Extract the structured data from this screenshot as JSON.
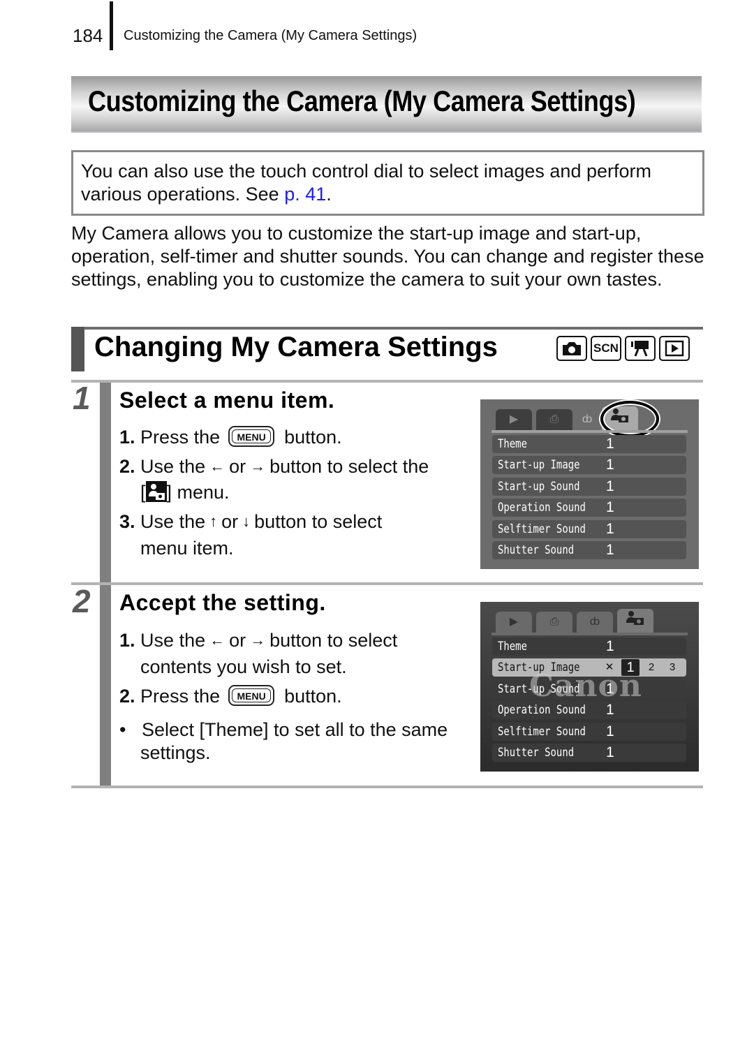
{
  "header": {
    "page_number": "184",
    "running_title": "Customizing the Camera (My Camera Settings)"
  },
  "title": "Customizing the Camera (My Camera Settings)",
  "note": {
    "text_before": "You can also use the touch control dial to select images and perform various operations. See ",
    "link": "p. 41",
    "text_after": "."
  },
  "intro": "My Camera allows you to customize the start-up image and start-up, operation, self-timer and shutter sounds. You can change and register these settings, enabling you to customize the camera to suit your own tastes.",
  "section": {
    "title": "Changing My Camera Settings",
    "mode_icons": [
      {
        "name": "camera-icon",
        "label": "◘"
      },
      {
        "name": "scn-icon",
        "label": "SCN"
      },
      {
        "name": "movie-icon",
        "label": "🎥"
      },
      {
        "name": "playback-icon",
        "label": "▶"
      }
    ]
  },
  "steps": [
    {
      "number": "1",
      "title": "Select a menu item.",
      "instructions": {
        "i1_num": "1.",
        "i1_a": "Press the",
        "i1_btn": "MENU",
        "i1_b": "button.",
        "i2_num": "2.",
        "i2_a": "Use the",
        "i2_arrow1": "←",
        "i2_or": "or",
        "i2_arrow2": "→",
        "i2_b": "button to select the",
        "i2_c_open": "[",
        "i2_c_close": "] menu.",
        "i3_num": "3.",
        "i3_a": "Use the",
        "i3_arrow1": "↑",
        "i3_or": "or",
        "i3_arrow2": "↓",
        "i3_b": "button to select",
        "i3_c": "menu item."
      },
      "screen": {
        "tabs": [
          "▶",
          "⎙",
          "ȸ",
          "👤"
        ],
        "rows": [
          {
            "label": "Theme",
            "value": "1"
          },
          {
            "label": "Start-up Image",
            "value": "1"
          },
          {
            "label": "Start-up Sound",
            "value": "1"
          },
          {
            "label": "Operation Sound",
            "value": "1"
          },
          {
            "label": "Selftimer Sound",
            "value": "1"
          },
          {
            "label": "Shutter Sound",
            "value": "1"
          }
        ]
      }
    },
    {
      "number": "2",
      "title": "Accept the setting.",
      "instructions": {
        "i1_num": "1.",
        "i1_a": "Use the",
        "i1_arrow1": "←",
        "i1_or": "or",
        "i1_arrow2": "→",
        "i1_b": "button to select",
        "i1_c": "contents you wish to set.",
        "i2_num": "2.",
        "i2_a": "Press the",
        "i2_btn": "MENU",
        "i2_b": "button.",
        "bullet": "•",
        "bullet_text": "Select [Theme] to set all to the same",
        "bullet_text2": "settings."
      },
      "screen": {
        "tabs": [
          "▶",
          "⎙",
          "ȸ",
          "👤"
        ],
        "watermark": "Canon",
        "rows": [
          {
            "label": "Theme",
            "value": "1"
          },
          {
            "label": "Start-up Image",
            "options": [
              "✕",
              "1",
              "2",
              "3"
            ],
            "selected": "1"
          },
          {
            "label": "Start-up Sound",
            "value": "1"
          },
          {
            "label": "Operation Sound",
            "value": "1"
          },
          {
            "label": "Selftimer Sound",
            "value": "1"
          },
          {
            "label": "Shutter Sound",
            "value": "1"
          }
        ]
      }
    }
  ]
}
